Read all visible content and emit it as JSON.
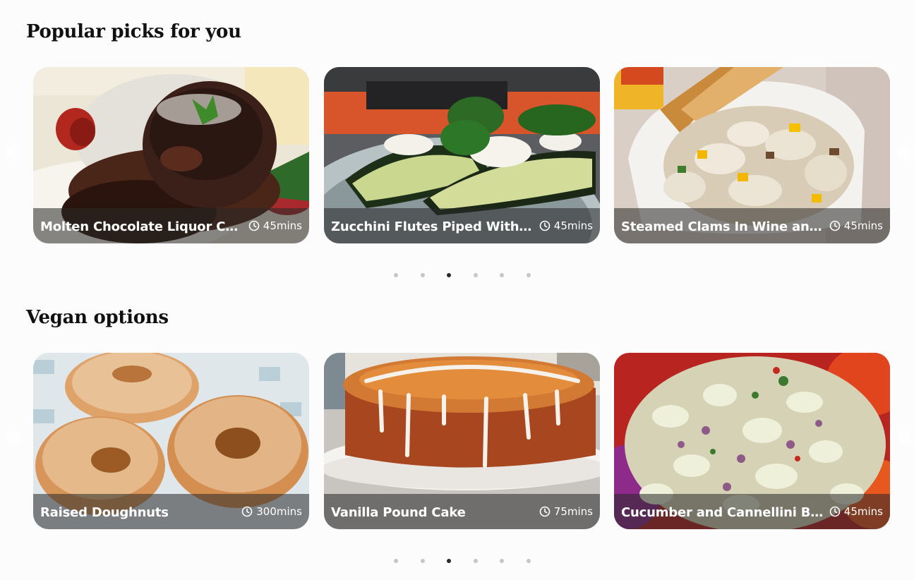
{
  "sections": [
    {
      "title": "Popular picks for you",
      "cards": [
        {
          "name": "Molten Chocolate Liquor Cakes",
          "time": "45mins",
          "image": "molten-chocolate-cake-photo"
        },
        {
          "name": "Zucchini Flutes Piped With Goat Cheese",
          "time": "45mins",
          "image": "zucchini-flutes-photo"
        },
        {
          "name": "Steamed Clams In Wine and Garlic",
          "time": "45mins",
          "image": "steamed-clams-photo"
        }
      ],
      "pagination": {
        "pages": 6,
        "active": 3
      }
    },
    {
      "title": "Vegan options",
      "cards": [
        {
          "name": "Raised Doughnuts",
          "time": "300mins",
          "image": "raised-doughnuts-photo"
        },
        {
          "name": "Vanilla Pound Cake",
          "time": "75mins",
          "image": "vanilla-pound-cake-photo"
        },
        {
          "name": "Cucumber and Cannellini Bean Salad",
          "time": "45mins",
          "image": "cucumber-cannellini-salad-photo"
        }
      ],
      "pagination": {
        "pages": 6,
        "active": 3
      }
    }
  ],
  "icons": {
    "time": "clock-icon"
  },
  "colors": {
    "background": "#fcfcfc",
    "dot_inactive": "#c6c6c6",
    "dot_active": "#2a2a2a",
    "overlay_bar": "rgba(40,40,40,0.55)"
  }
}
